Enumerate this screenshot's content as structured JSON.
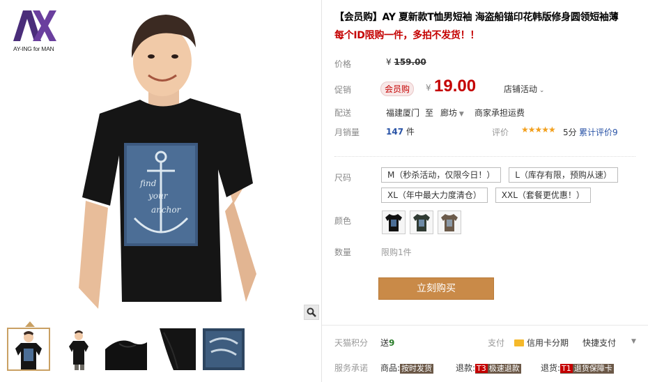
{
  "brand": {
    "logo_letters": "AY",
    "logo_sub": "AY-ING for MAN",
    "shirt_text": [
      "find",
      "your",
      "anchor"
    ]
  },
  "product": {
    "title": "【会员购】AY 夏新款T恤男短袖 海盗船锚印花韩版修身圆领短袖薄",
    "subtitle": "每个ID限购一件，多拍不发货！！"
  },
  "price": {
    "label": "价格",
    "currency": "¥",
    "original": "159.00",
    "promo_label": "促销",
    "promo_badge": "会员购",
    "promo_price": "19.00",
    "store_activity": "店铺活动"
  },
  "shipping": {
    "label": "配送",
    "from": "福建厦门",
    "to_word": "至",
    "dest": "廊坊",
    "fee": "商家承担运费"
  },
  "sales": {
    "label": "月销量",
    "count": "147",
    "unit": "件",
    "rating_label": "评价",
    "stars": "★★★★★",
    "score": "5分",
    "reviews": "累计评价9"
  },
  "sizes": {
    "label": "尺码",
    "options": [
      "M（秒杀活动，仅限今日！）",
      "L（库存有限，预购从速）",
      "XL（年中最大力度清仓）",
      "XXL（套餐更优惠！）"
    ]
  },
  "colors": {
    "label": "颜色",
    "swatches": [
      "#111111",
      "#2f3a32",
      "#6b5a4a"
    ]
  },
  "quantity": {
    "label": "数量",
    "value": "限购1件"
  },
  "buy_button": "立刻购买",
  "bottom": {
    "points_label": "天猫积分",
    "points_prefix": "送",
    "points_value": "9",
    "pay_label": "支付",
    "credit": "信用卡分期",
    "quick_pay": "快捷支付",
    "promise_label": "服务承诺",
    "goods": "商品:",
    "goods_tag": "按时发货",
    "refund": "退款:",
    "refund_hi": "T3",
    "refund_tag": "极速退款",
    "return": "退货:",
    "return_hi": "T1",
    "return_tag": "退货保障卡"
  }
}
